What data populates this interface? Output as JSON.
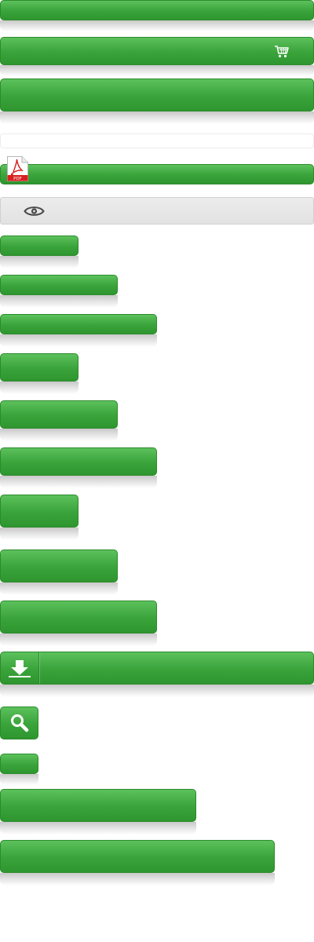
{
  "icons": {
    "cart": "shopping-cart-icon",
    "pdf": "pdf-file-icon",
    "pdf_badge": "PDF",
    "eye": "eye-icon",
    "download": "download-arrow-icon",
    "search": "magnifier-icon"
  },
  "colors": {
    "accent_green": "#3aa33a",
    "green_border": "#2d8b2d",
    "gray_button": "#e6e6e6",
    "pdf_red": "#d9201f"
  },
  "buttons": {
    "b1": "",
    "b2": "",
    "b3": "",
    "pdf": "",
    "view": "",
    "s1": "",
    "s2": "",
    "s3": "",
    "m1": "",
    "m2": "",
    "m3": "",
    "l1": "",
    "l2": "",
    "l3": "",
    "download": "",
    "search": "",
    "tiny": "",
    "w250": "",
    "w350": ""
  }
}
